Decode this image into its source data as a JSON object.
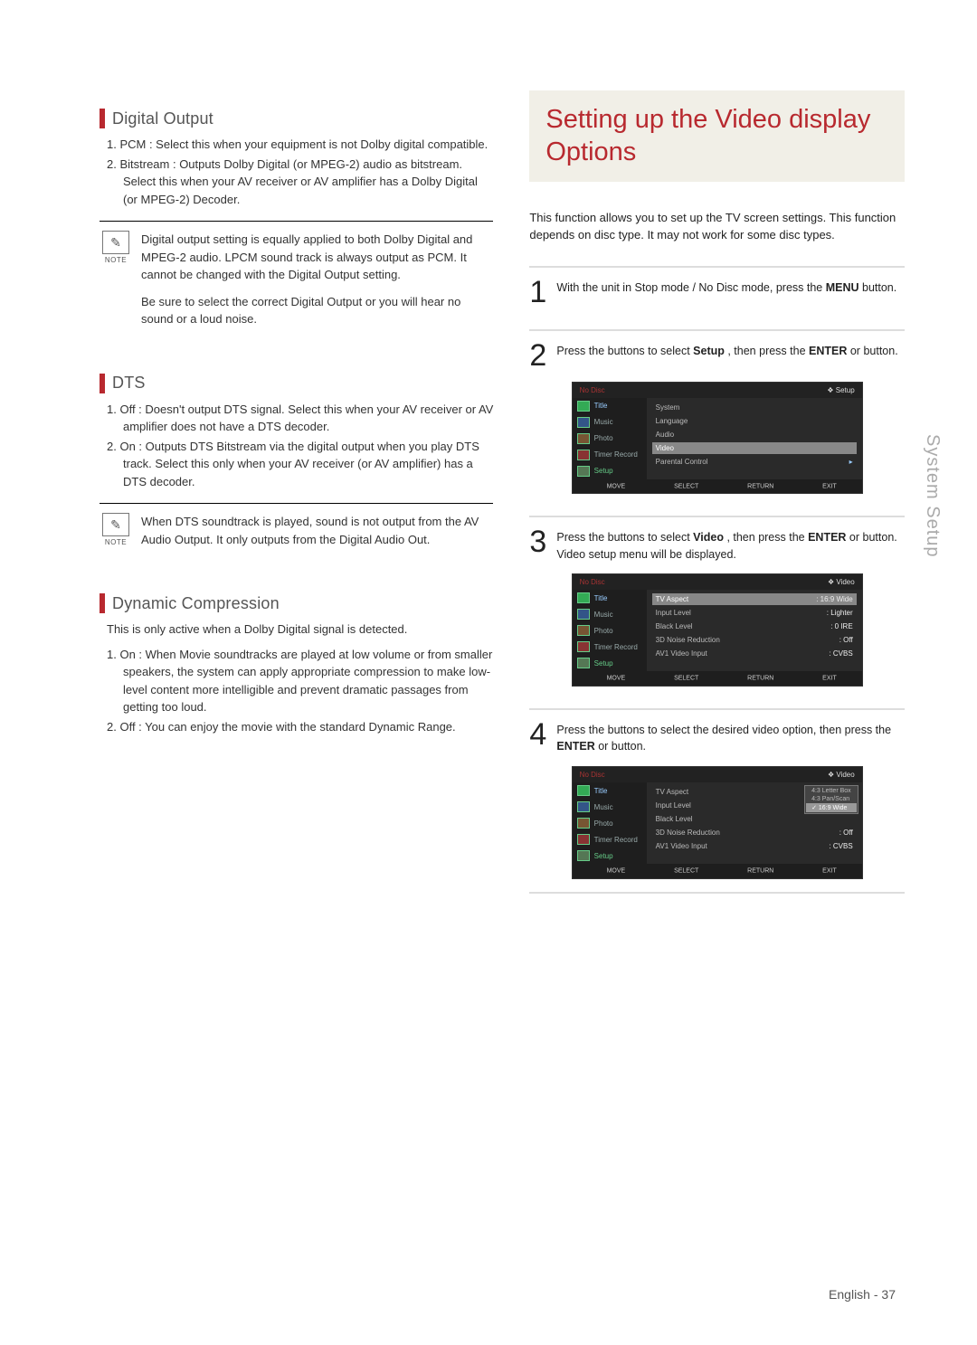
{
  "left": {
    "digital_output": {
      "title": "Digital Output",
      "item1": "1. PCM : Select this when your equipment is not Dolby digital compatible.",
      "item2": "2. Bitstream : Outputs Dolby Digital (or MPEG-2) audio as bitstream. Select this when your AV receiver or AV amplifier has a Dolby Digital (or MPEG-2) Decoder.",
      "note1": "Digital output setting is equally applied to both Dolby Digital and MPEG-2 audio. LPCM sound track is always output as PCM. It cannot be changed with the Digital Output setting.",
      "note2": "Be sure to select the correct Digital Output or you will hear no sound or a loud noise."
    },
    "dts": {
      "title": "DTS",
      "item1": "1. Off : Doesn't output DTS signal. Select this when your AV receiver or AV amplifier does not have a DTS decoder.",
      "item2": "2. On : Outputs DTS Bitstream via the digital output when you play DTS track. Select this only when your AV receiver (or AV amplifier) has a DTS decoder.",
      "note1": "When DTS soundtrack is played, sound is not output from the AV Audio Output. It only outputs from the Digital Audio Out."
    },
    "dynamic": {
      "title": "Dynamic Compression",
      "intro": "This is only active when a Dolby Digital signal is detected.",
      "item1": "1. On : When Movie soundtracks are played at low volume or from smaller speakers, the system can apply appropriate compression to make low-level content more intelligible and prevent dramatic passages from getting too loud.",
      "item2": "2. Off : You can enjoy the movie with the standard Dynamic Range."
    },
    "note_label": "NOTE"
  },
  "right": {
    "title": "Setting up the Video display Options",
    "intro": "This function allows you to set up the TV screen settings. This function depends on disc type. It may not work for some disc types.",
    "step1": {
      "a": "With the unit in Stop mode / No Disc mode, press the ",
      "b": "MENU",
      "c": " button."
    },
    "step2": {
      "a": "Press the ",
      "b": " buttons to select ",
      "c": "Setup",
      "d": " , then press the ",
      "e": "ENTER",
      "f": " or ",
      "g": " button."
    },
    "step3": {
      "a": "Press the ",
      "b": " buttons to select ",
      "c": "Video",
      "d": " , then press the ",
      "e": "ENTER",
      "f": " or ",
      "g": " button.",
      "h": "Video setup menu will be displayed."
    },
    "step4": {
      "a": "Press the ",
      "b": " buttons to select the desired video option, then press the ",
      "c": "ENTER",
      "d": " or ",
      "e": " button."
    }
  },
  "osd": {
    "nodisc": "No Disc",
    "hdr_setup": "Setup",
    "hdr_video": "Video",
    "left_items": [
      "Title",
      "Music",
      "Photo",
      "Timer Record",
      "Setup"
    ],
    "setup_opts": {
      "system": "System",
      "language": "Language",
      "audio": "Audio",
      "video": "Video",
      "parental": "Parental Control"
    },
    "video_opts": {
      "tv_aspect": {
        "k": "TV Aspect",
        "v": ": 16:9 Wide"
      },
      "input_level": {
        "k": "Input Level",
        "v": ": Lighter"
      },
      "black_level": {
        "k": "Black Level",
        "v": ": 0 IRE"
      },
      "nr": {
        "k": "3D Noise Reduction",
        "v": ": Off"
      },
      "av1": {
        "k": "AV1 Video Input",
        "v": ": CVBS"
      }
    },
    "dd": {
      "a": "4:3 Letter Box",
      "b": "4:3 Pan/Scan",
      "c": "16:9 Wide"
    },
    "foot": {
      "move": "MOVE",
      "select": "SELECT",
      "return": "RETURN",
      "exit": "EXIT"
    }
  },
  "side_tab": "System Setup",
  "footer": {
    "lang": "English",
    "page": "37"
  }
}
